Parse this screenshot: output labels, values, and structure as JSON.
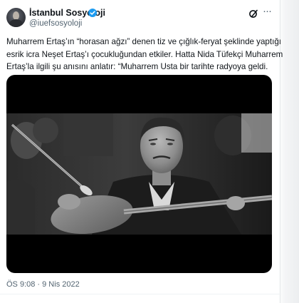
{
  "account": {
    "display_name": "İstanbul Sosyoloji",
    "handle": "@iuefsosyoloji",
    "avatar_icon": "avatar-photo-icon",
    "verified_icon": "verified-badge-icon",
    "verified_color": "#1d9bf0"
  },
  "actions": {
    "grok_icon": "grok-icon",
    "more_icon": "more-options-icon"
  },
  "tweet": {
    "text_lines": [
      "Muharrem Ertaş’ın “horasan ağzı” denen tiz ve çığlık-feryat şeklinde yaptığı",
      "esrik icra Neşet Ertaş’ı çocukluğundan etkiler. Hatta Nida Tüfekçi Muharrem",
      "Ertaş’la ilgili şu anısını anlatır: “Muharrem Usta bir tarihte radyoya geldi."
    ],
    "timestamp": "ÖS 9:08 · 9 Nis 2022"
  },
  "media": {
    "kind": "black-and-white photo of a saz player"
  },
  "colors": {
    "text": "#0f1419",
    "secondary": "#536471",
    "media_bg": "#000000"
  }
}
